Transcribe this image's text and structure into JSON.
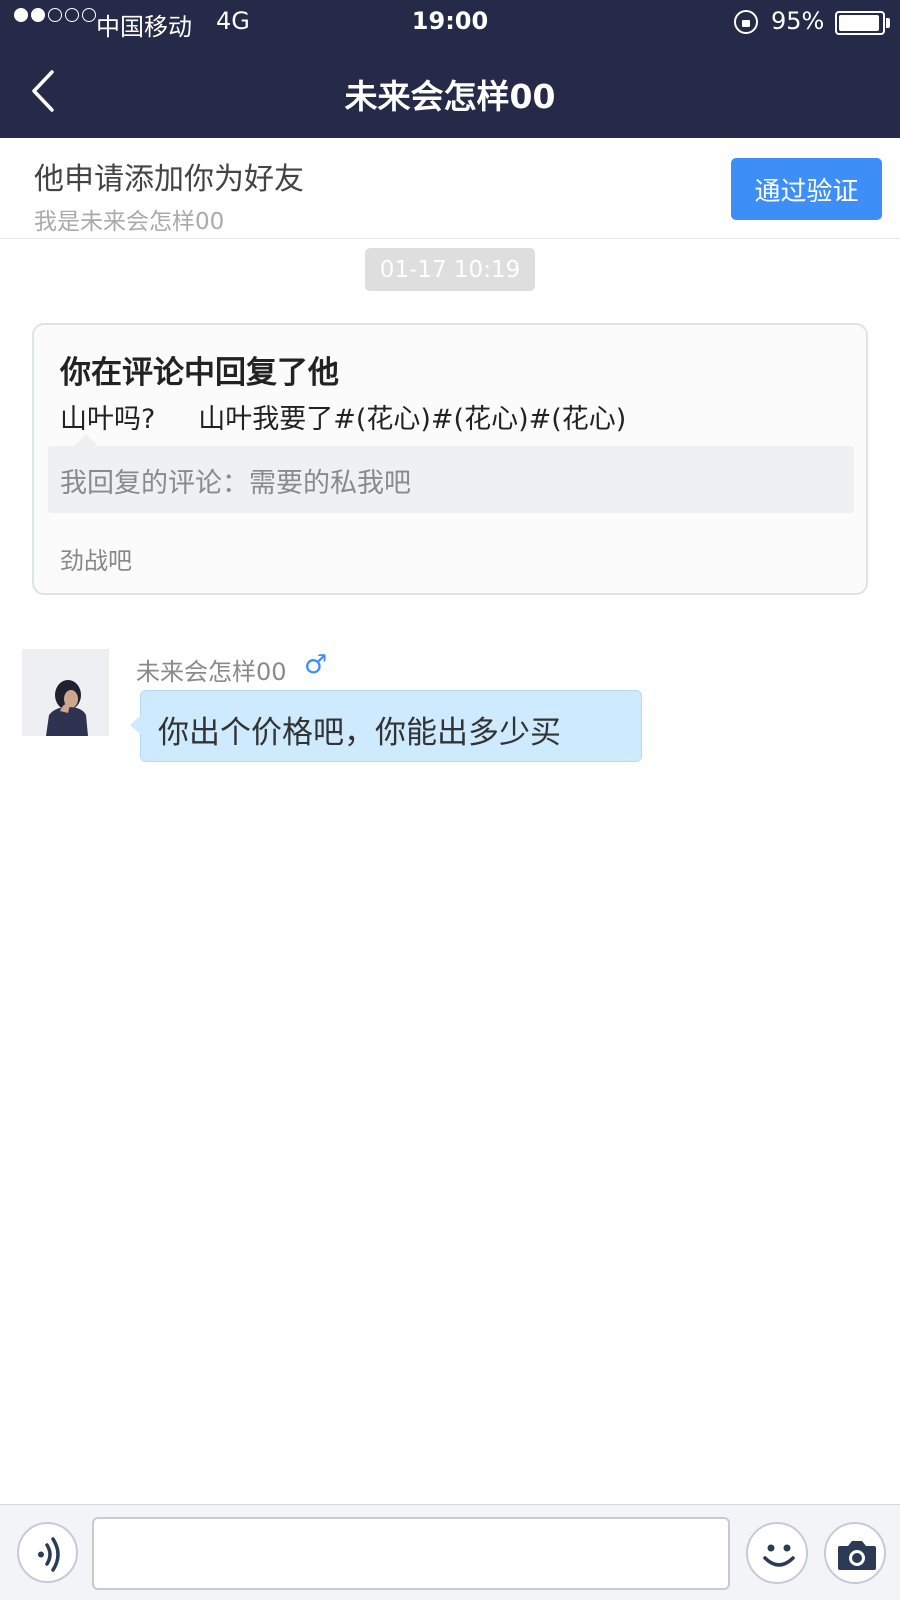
{
  "status_bar": {
    "carrier": "中国移动",
    "network": "4G",
    "time": "19:00",
    "battery_percent": "95%",
    "battery_level": 0.95,
    "signal_bars_filled": 2,
    "signal_bars_total": 5
  },
  "nav": {
    "title": "未来会怎样00",
    "back_icon": "chevron-left-icon"
  },
  "friend_request": {
    "title": "他申请添加你为好友",
    "message": "我是未来会怎样00",
    "accept_label": "通过验证",
    "accent_color": "#3d8ef7"
  },
  "timestamp": "01-17 10:19",
  "comment_card": {
    "title": "你在评论中回复了他",
    "reply_text": "山叶吗?     山叶我要了#(花心)#(花心)#(花心)",
    "quote": "我回复的评论：需要的私我吧",
    "footer": "劲战吧"
  },
  "message": {
    "sender": "未来会怎样00",
    "gender_symbol": "♂",
    "text": "你出个价格吧，你能出多少买",
    "bubble_color": "#cdeafe"
  },
  "input_bar": {
    "value": "",
    "voice_icon": "voice-icon",
    "emoji_icon": "emoji-icon",
    "camera_icon": "camera-icon"
  },
  "colors": {
    "header_bg": "#252a48"
  }
}
